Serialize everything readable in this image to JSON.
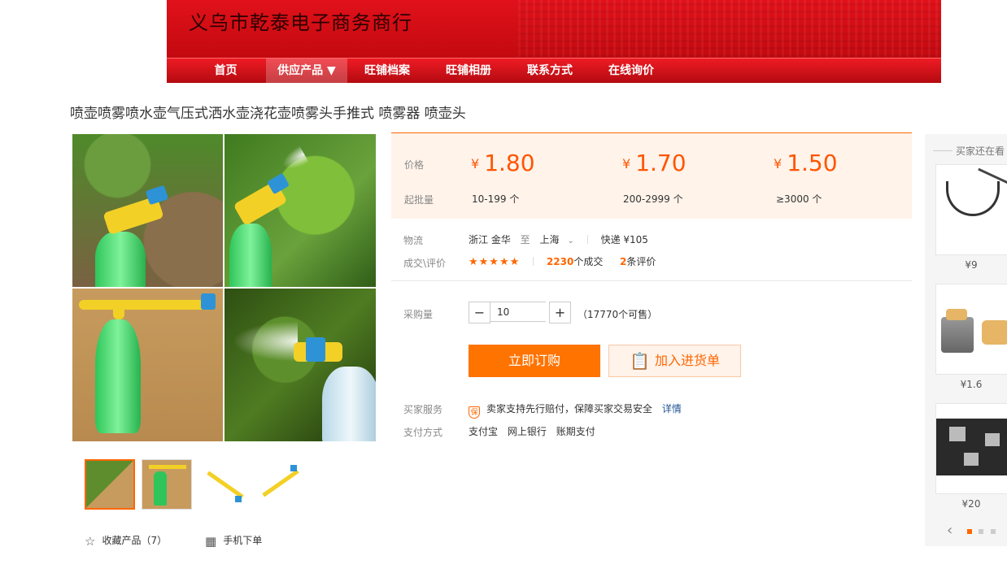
{
  "header": {
    "shop_name": "义乌市乾泰电子商务商行",
    "nav": [
      {
        "label": "首页"
      },
      {
        "label": "供应产品 ▼"
      },
      {
        "label": "旺铺档案"
      },
      {
        "label": "旺铺相册"
      },
      {
        "label": "联系方式"
      },
      {
        "label": "在线询价"
      }
    ]
  },
  "product": {
    "title": "喷壶喷雾喷水壶气压式洒水壶浇花壶喷雾头手推式 喷雾器 喷壶头"
  },
  "price_panel": {
    "price_label": "价格",
    "batch_label": "起批量",
    "currency": "¥",
    "tiers": [
      {
        "price": "1.80",
        "batch": "10-199 个"
      },
      {
        "price": "1.70",
        "batch": "200-2999 个"
      },
      {
        "price": "1.50",
        "batch": "≥3000 个"
      }
    ]
  },
  "logistics": {
    "label": "物流",
    "from": "浙江 金华",
    "to_word": "至",
    "to": "上海",
    "shipping": "快递 ¥105"
  },
  "deals": {
    "label": "成交\\评价",
    "stars": "★★★★★",
    "deal_count": "2230",
    "deal_suffix": "个成交",
    "review_count": "2",
    "review_suffix": "条评价"
  },
  "purchase": {
    "label": "采购量",
    "minus": "−",
    "plus": "+",
    "quantity": "10",
    "available": "（17770个可售）"
  },
  "actions": {
    "buy_now": "立即订购",
    "add_to_list": "加入进货单"
  },
  "service": {
    "label": "买家服务",
    "badge": "保",
    "text": "卖家支持先行赔付，保障买家交易安全",
    "link": "详情"
  },
  "payment": {
    "label": "支付方式",
    "methods": [
      "支付宝",
      "网上银行",
      "账期支付"
    ]
  },
  "extras": {
    "favorite": "收藏产品（7）",
    "mobile": "手机下单"
  },
  "rail": {
    "title": "买家还在看",
    "items": [
      {
        "price": "¥9"
      },
      {
        "price": "¥1.6"
      },
      {
        "price": "¥20"
      }
    ]
  },
  "icons": {
    "star": "star-outline-icon",
    "qr": "qr-code-icon",
    "clipboard": "clipboard-icon",
    "chevron": "chevron-down-icon",
    "arrow_left": "arrow-left-icon"
  },
  "colors": {
    "accent": "#ff6600",
    "header_red": "#d10f17",
    "link": "#1e5494"
  }
}
